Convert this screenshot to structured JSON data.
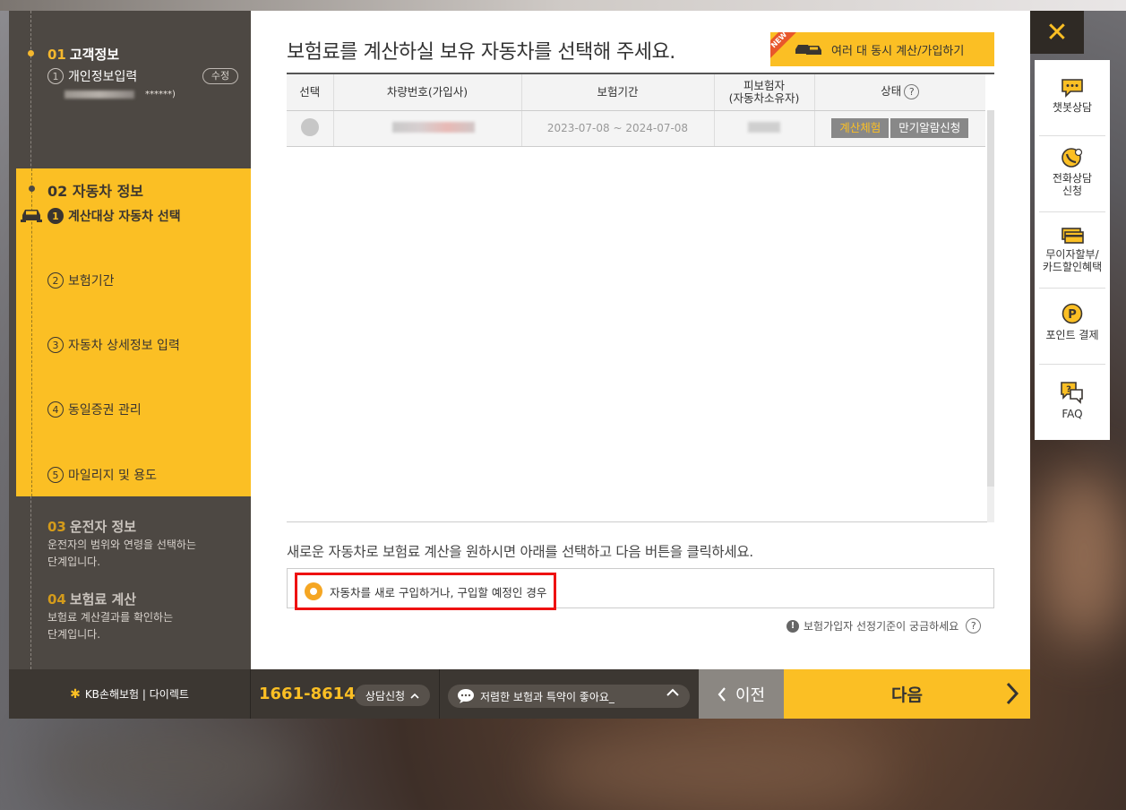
{
  "sidebar": {
    "step1": {
      "num": "01",
      "title": "고객정보",
      "sub_num": "1",
      "sub_label": "개인정보입력",
      "edit_label": "수정",
      "masked_suffix": "******)"
    },
    "step2": {
      "num": "02",
      "title": "자동차 정보",
      "subs": [
        {
          "num": "1",
          "label": "계산대상 자동차 선택"
        },
        {
          "num": "2",
          "label": "보험기간"
        },
        {
          "num": "3",
          "label": "자동차 상세정보 입력"
        },
        {
          "num": "4",
          "label": "동일증권 관리"
        },
        {
          "num": "5",
          "label": "마일리지 및 용도"
        }
      ]
    },
    "step3": {
      "num": "03",
      "title": "운전자 정보",
      "desc1": "운전자의 범위와 연령을 선택하는",
      "desc2": "단계입니다."
    },
    "step4": {
      "num": "04",
      "title": "보험료 계산",
      "desc1": "보험료 계산결과를 확인하는",
      "desc2": "단계입니다."
    }
  },
  "main": {
    "title": "보험료를 계산하실 보유 자동차를 선택해 주세요.",
    "multi_button": "여러 대 동시 계산/가입하기",
    "new_badge": "NEW",
    "table": {
      "headers": [
        "선택",
        "차량번호(가입사)",
        "보험기간",
        "피보험자",
        "(자동차소유자)",
        "상태"
      ],
      "status_help": "?",
      "row": {
        "period": "2023-07-08 ~ 2024-07-08",
        "calc_button": "계산체험",
        "alarm_button": "만기알람신청"
      }
    },
    "new_car_text": "새로운 자동차로 보험료 계산을 원하시면 아래를 선택하고 다음 버튼을 클릭하세요.",
    "new_car_option": "자동차를 새로 구입하거나, 구입할 예정인 경우",
    "criteria_text": "보험가입자 선정기준이 궁금하세요",
    "criteria_excl": "!",
    "criteria_help": "?"
  },
  "right_panel": {
    "close": "✕",
    "items": [
      {
        "label": "챗봇상담"
      },
      {
        "label1": "전화상담",
        "label2": "신청"
      },
      {
        "label1": "무이자할부/",
        "label2": "카드할인혜택"
      },
      {
        "label": "포인트 결제"
      },
      {
        "label": "FAQ"
      }
    ]
  },
  "bottom": {
    "logo": "KB손해보험 | 다이렉트",
    "phone": "1661-8614",
    "consult": "상담신청",
    "chat": "저렴한 보험과 특약이 좋아요_",
    "prev": "이전",
    "next": "다음"
  },
  "colors": {
    "accent": "#fbbf24",
    "sidebar": "#4d4843",
    "highlight_red": "#ee1111"
  }
}
